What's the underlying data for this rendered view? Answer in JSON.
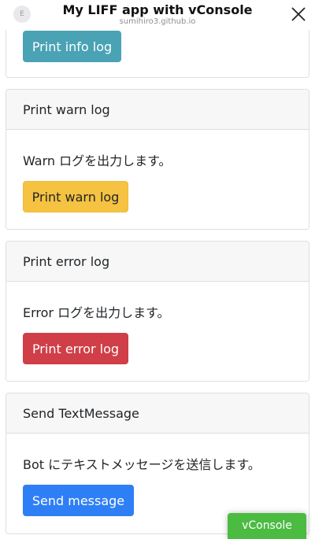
{
  "header": {
    "app_icon_glyph": "E",
    "title": "My LIFF app with vConsole",
    "subtitle": "sumihiro3.github.io",
    "close_icon": "close-icon"
  },
  "cards": {
    "info": {
      "button_label": "Print info log",
      "color": "#4aa2b5"
    },
    "warn": {
      "header": "Print warn log",
      "text": "Warn ログを出力します。",
      "button_label": "Print warn log",
      "color": "#f5c241"
    },
    "error": {
      "header": "Print error log",
      "text": "Error ログを出力します。",
      "button_label": "Print error log",
      "color": "#d03e47"
    },
    "send": {
      "header": "Send TextMessage",
      "text": "Bot にテキストメッセージを送信します。",
      "button_label": "Send message",
      "color": "#2e7ff5"
    }
  },
  "vconsole": {
    "label": "vConsole",
    "color": "#4cbb41"
  }
}
